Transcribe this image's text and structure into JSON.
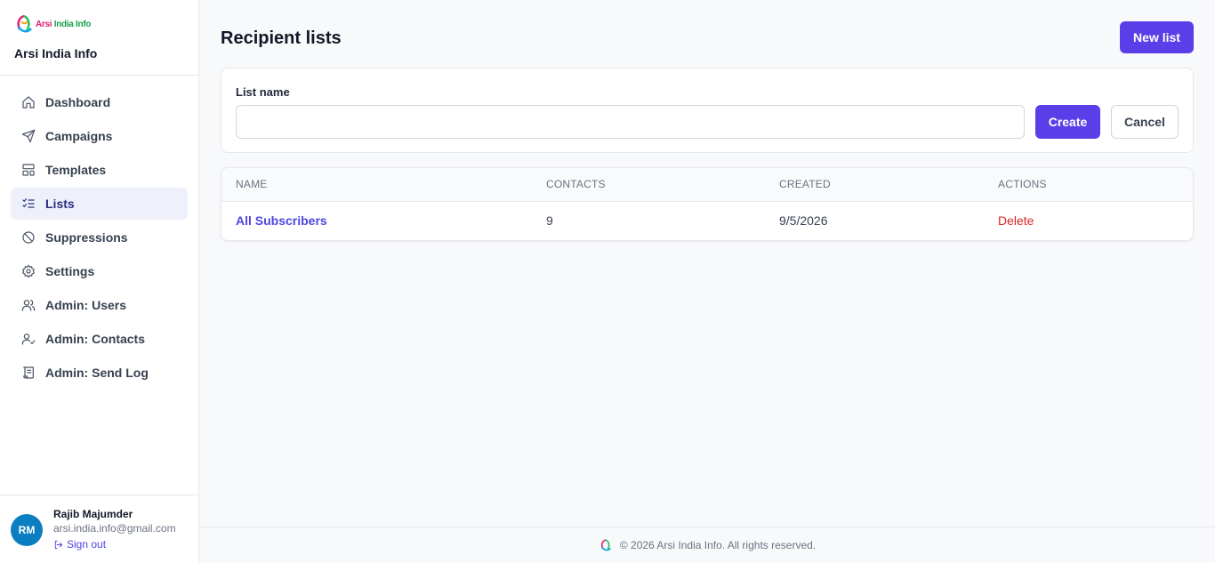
{
  "brand": {
    "logo_text_a": "Arsi ",
    "logo_text_b": "India Info",
    "name": "Arsi India Info"
  },
  "nav": [
    {
      "label": "Dashboard",
      "icon": "home-icon"
    },
    {
      "label": "Campaigns",
      "icon": "send-icon"
    },
    {
      "label": "Templates",
      "icon": "layout-icon"
    },
    {
      "label": "Lists",
      "icon": "list-check-icon",
      "active": true
    },
    {
      "label": "Suppressions",
      "icon": "ban-icon"
    },
    {
      "label": "Settings",
      "icon": "gear-icon"
    },
    {
      "label": "Admin: Users",
      "icon": "users-icon"
    },
    {
      "label": "Admin: Contacts",
      "icon": "user-check-icon"
    },
    {
      "label": "Admin: Send Log",
      "icon": "scroll-icon"
    }
  ],
  "user": {
    "initials": "RM",
    "name": "Rajib Majumder",
    "email": "arsi.india.info@gmail.com",
    "signout_label": "Sign out"
  },
  "page": {
    "title": "Recipient lists",
    "new_list_label": "New list"
  },
  "form": {
    "label": "List name",
    "value": "",
    "placeholder": "",
    "create_label": "Create",
    "cancel_label": "Cancel"
  },
  "table": {
    "headers": [
      "NAME",
      "CONTACTS",
      "CREATED",
      "ACTIONS"
    ],
    "rows": [
      {
        "name": "All Subscribers",
        "contacts": "9",
        "created": "9/5/2026",
        "action": "Delete"
      }
    ]
  },
  "footer": {
    "text": "© 2026 Arsi India Info. All rights reserved."
  },
  "colors": {
    "primary": "#5a3ee8",
    "link": "#4f46e5",
    "danger": "#dc2626",
    "avatar": "#0b7ec2",
    "active_nav_bg": "#eef0fb"
  }
}
